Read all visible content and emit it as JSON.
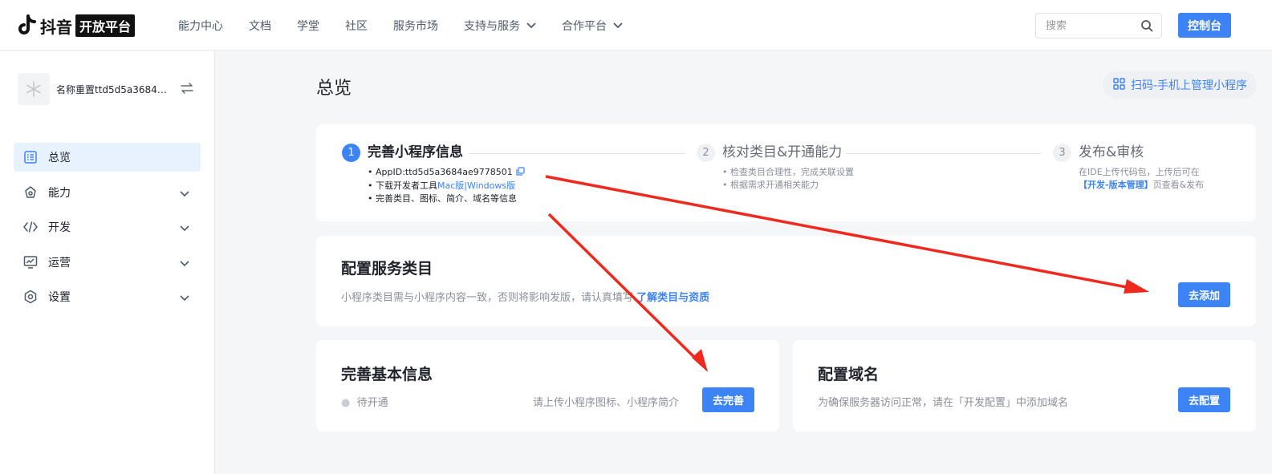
{
  "brand": {
    "name": "抖音",
    "badge": "开放平台"
  },
  "nav": {
    "items": [
      "能力中心",
      "文档",
      "学堂",
      "社区",
      "服务市场"
    ],
    "dropdowns": [
      "支持与服务",
      "合作平台"
    ],
    "search_placeholder": "搜索",
    "console_label": "控制台"
  },
  "sidebar": {
    "app_name": "名称重置ttd5d5a3684a...",
    "menu": [
      {
        "label": "总览",
        "icon": "overview-icon",
        "active": true
      },
      {
        "label": "能力",
        "icon": "capability-icon"
      },
      {
        "label": "开发",
        "icon": "code-icon"
      },
      {
        "label": "运营",
        "icon": "operation-icon"
      },
      {
        "label": "设置",
        "icon": "settings-icon"
      }
    ]
  },
  "main": {
    "title": "总览",
    "scan_label": "扫码-手机上管理小程序",
    "steps": [
      {
        "num": "1",
        "title": "完善小程序信息",
        "appid": "AppID:ttd5d5a3684ae9778501",
        "download_prefix": "下载开发者工具",
        "mac_link": "Mac版",
        "sep": "|",
        "win_link": "Windows版",
        "complete_line": "完善类目、图标、简介、域名等信息"
      },
      {
        "num": "2",
        "title": "核对类目&开通能力",
        "lines": [
          "检查类目合理性，完成关联设置",
          "根据需求开通相关能力"
        ]
      },
      {
        "num": "3",
        "title": "发布&审核",
        "line1": "在IDE上传代码包，上传后可在",
        "link": "【开发-版本管理】",
        "line2_suffix": "页查看&发布"
      }
    ],
    "category": {
      "title": "配置服务类目",
      "desc": "小程序类目需与小程序内容一致，否则将影响发版，请认真填写",
      "link": "了解类目与资质",
      "button": "去添加"
    },
    "basic": {
      "title": "完善基本信息",
      "status": "待开通",
      "hint": "请上传小程序图标、小程序简介",
      "button": "去完善"
    },
    "domain": {
      "title": "配置域名",
      "desc": "为确保服务器访问正常，请在「开发配置」中添加域名",
      "button": "去配置"
    }
  },
  "colors": {
    "accent": "#3c83f6",
    "arrow": "#f0291f"
  }
}
